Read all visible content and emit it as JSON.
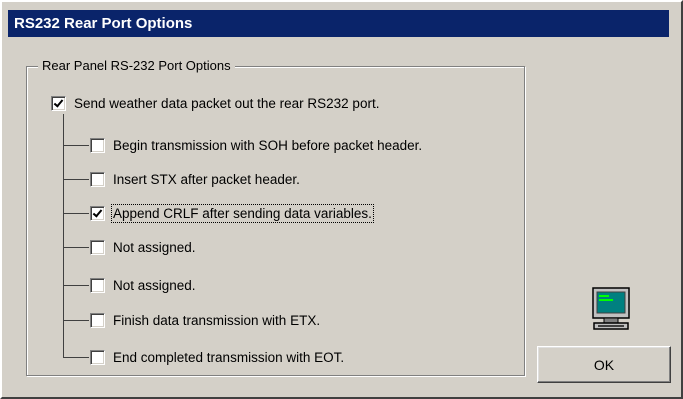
{
  "window": {
    "title": "RS232 Rear Port Options"
  },
  "group": {
    "label": "Rear Panel RS-232 Port Options"
  },
  "options": {
    "main": {
      "label": "Send weather data packet out the rear RS232 port.",
      "checked": true
    },
    "sub": [
      {
        "label": "Begin transmission with SOH before packet header.",
        "checked": false
      },
      {
        "label": "Insert STX after packet header.",
        "checked": false
      },
      {
        "label": "Append CRLF after sending data variables.",
        "checked": true
      },
      {
        "label": "Not assigned.",
        "checked": false
      },
      {
        "label": "Not assigned.",
        "checked": false
      },
      {
        "label": "Finish data transmission with ETX.",
        "checked": false
      },
      {
        "label": "End completed transmission with EOT.",
        "checked": false
      }
    ]
  },
  "buttons": {
    "ok_label": "OK"
  },
  "icons": {
    "computer": "computer-monitor-icon"
  },
  "colors": {
    "titlebar": "#0a246a",
    "dialog_bg": "#d4d0c8"
  }
}
